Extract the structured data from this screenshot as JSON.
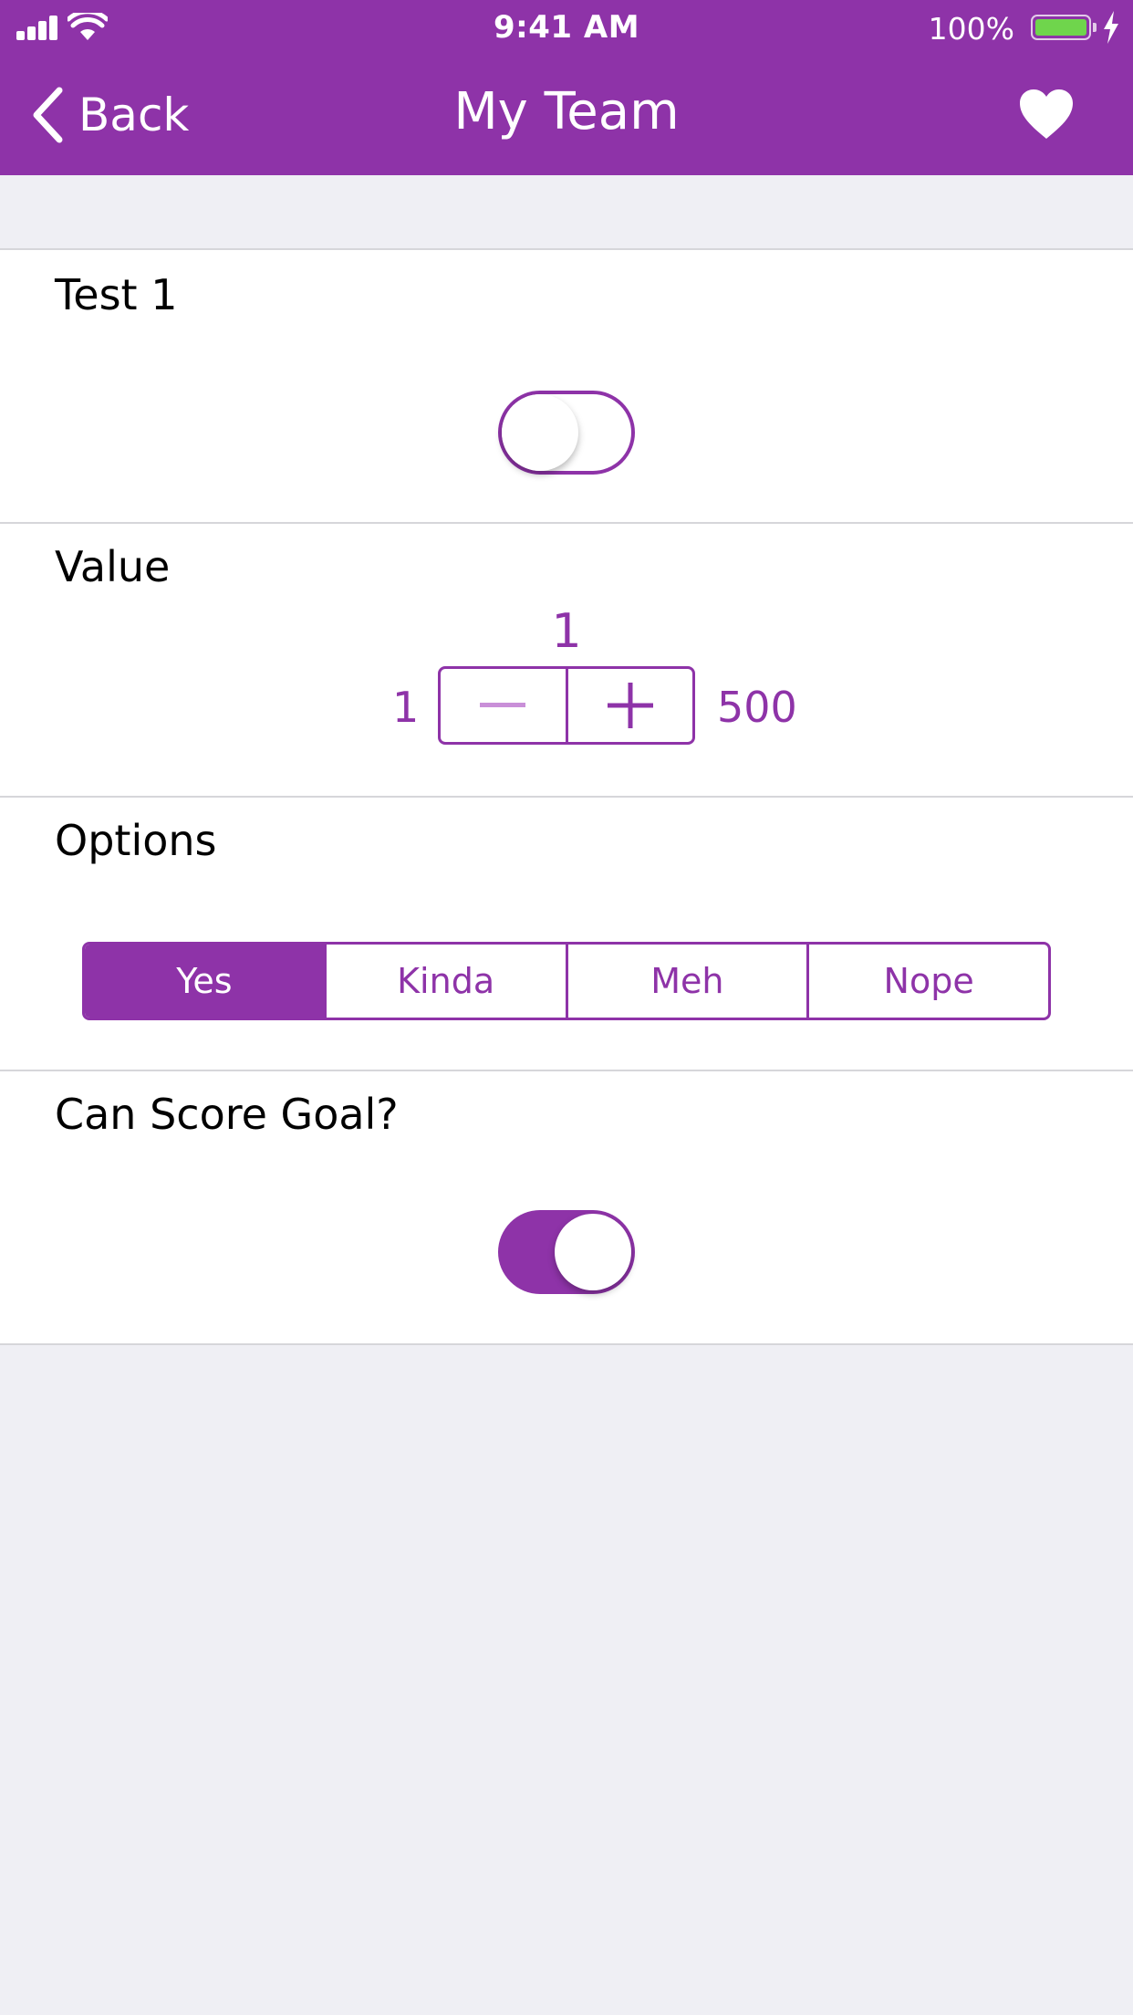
{
  "theme": {
    "accent": "#8e33a8",
    "background": "#efeff4",
    "battery_green": "#6fd54c"
  },
  "status_bar": {
    "time": "9:41 AM",
    "battery": "100%",
    "icons": [
      "signal-icon",
      "wifi-icon",
      "battery-icon",
      "charging-bolt-icon"
    ]
  },
  "nav": {
    "back_label": "Back",
    "title": "My Team",
    "back_icon": "chevron-left-icon",
    "favorite_icon": "heart-icon"
  },
  "rows": {
    "test1": {
      "label": "Test 1",
      "toggle_on": false
    },
    "value": {
      "label": "Value",
      "current": "1",
      "min": "1",
      "max": "500",
      "decrement_icon": "minus-icon",
      "increment_icon": "plus-icon"
    },
    "options": {
      "label": "Options",
      "segments": [
        "Yes",
        "Kinda",
        "Meh",
        "Nope"
      ],
      "selected": "Yes"
    },
    "goal": {
      "label": "Can Score Goal?",
      "toggle_on": true
    }
  }
}
